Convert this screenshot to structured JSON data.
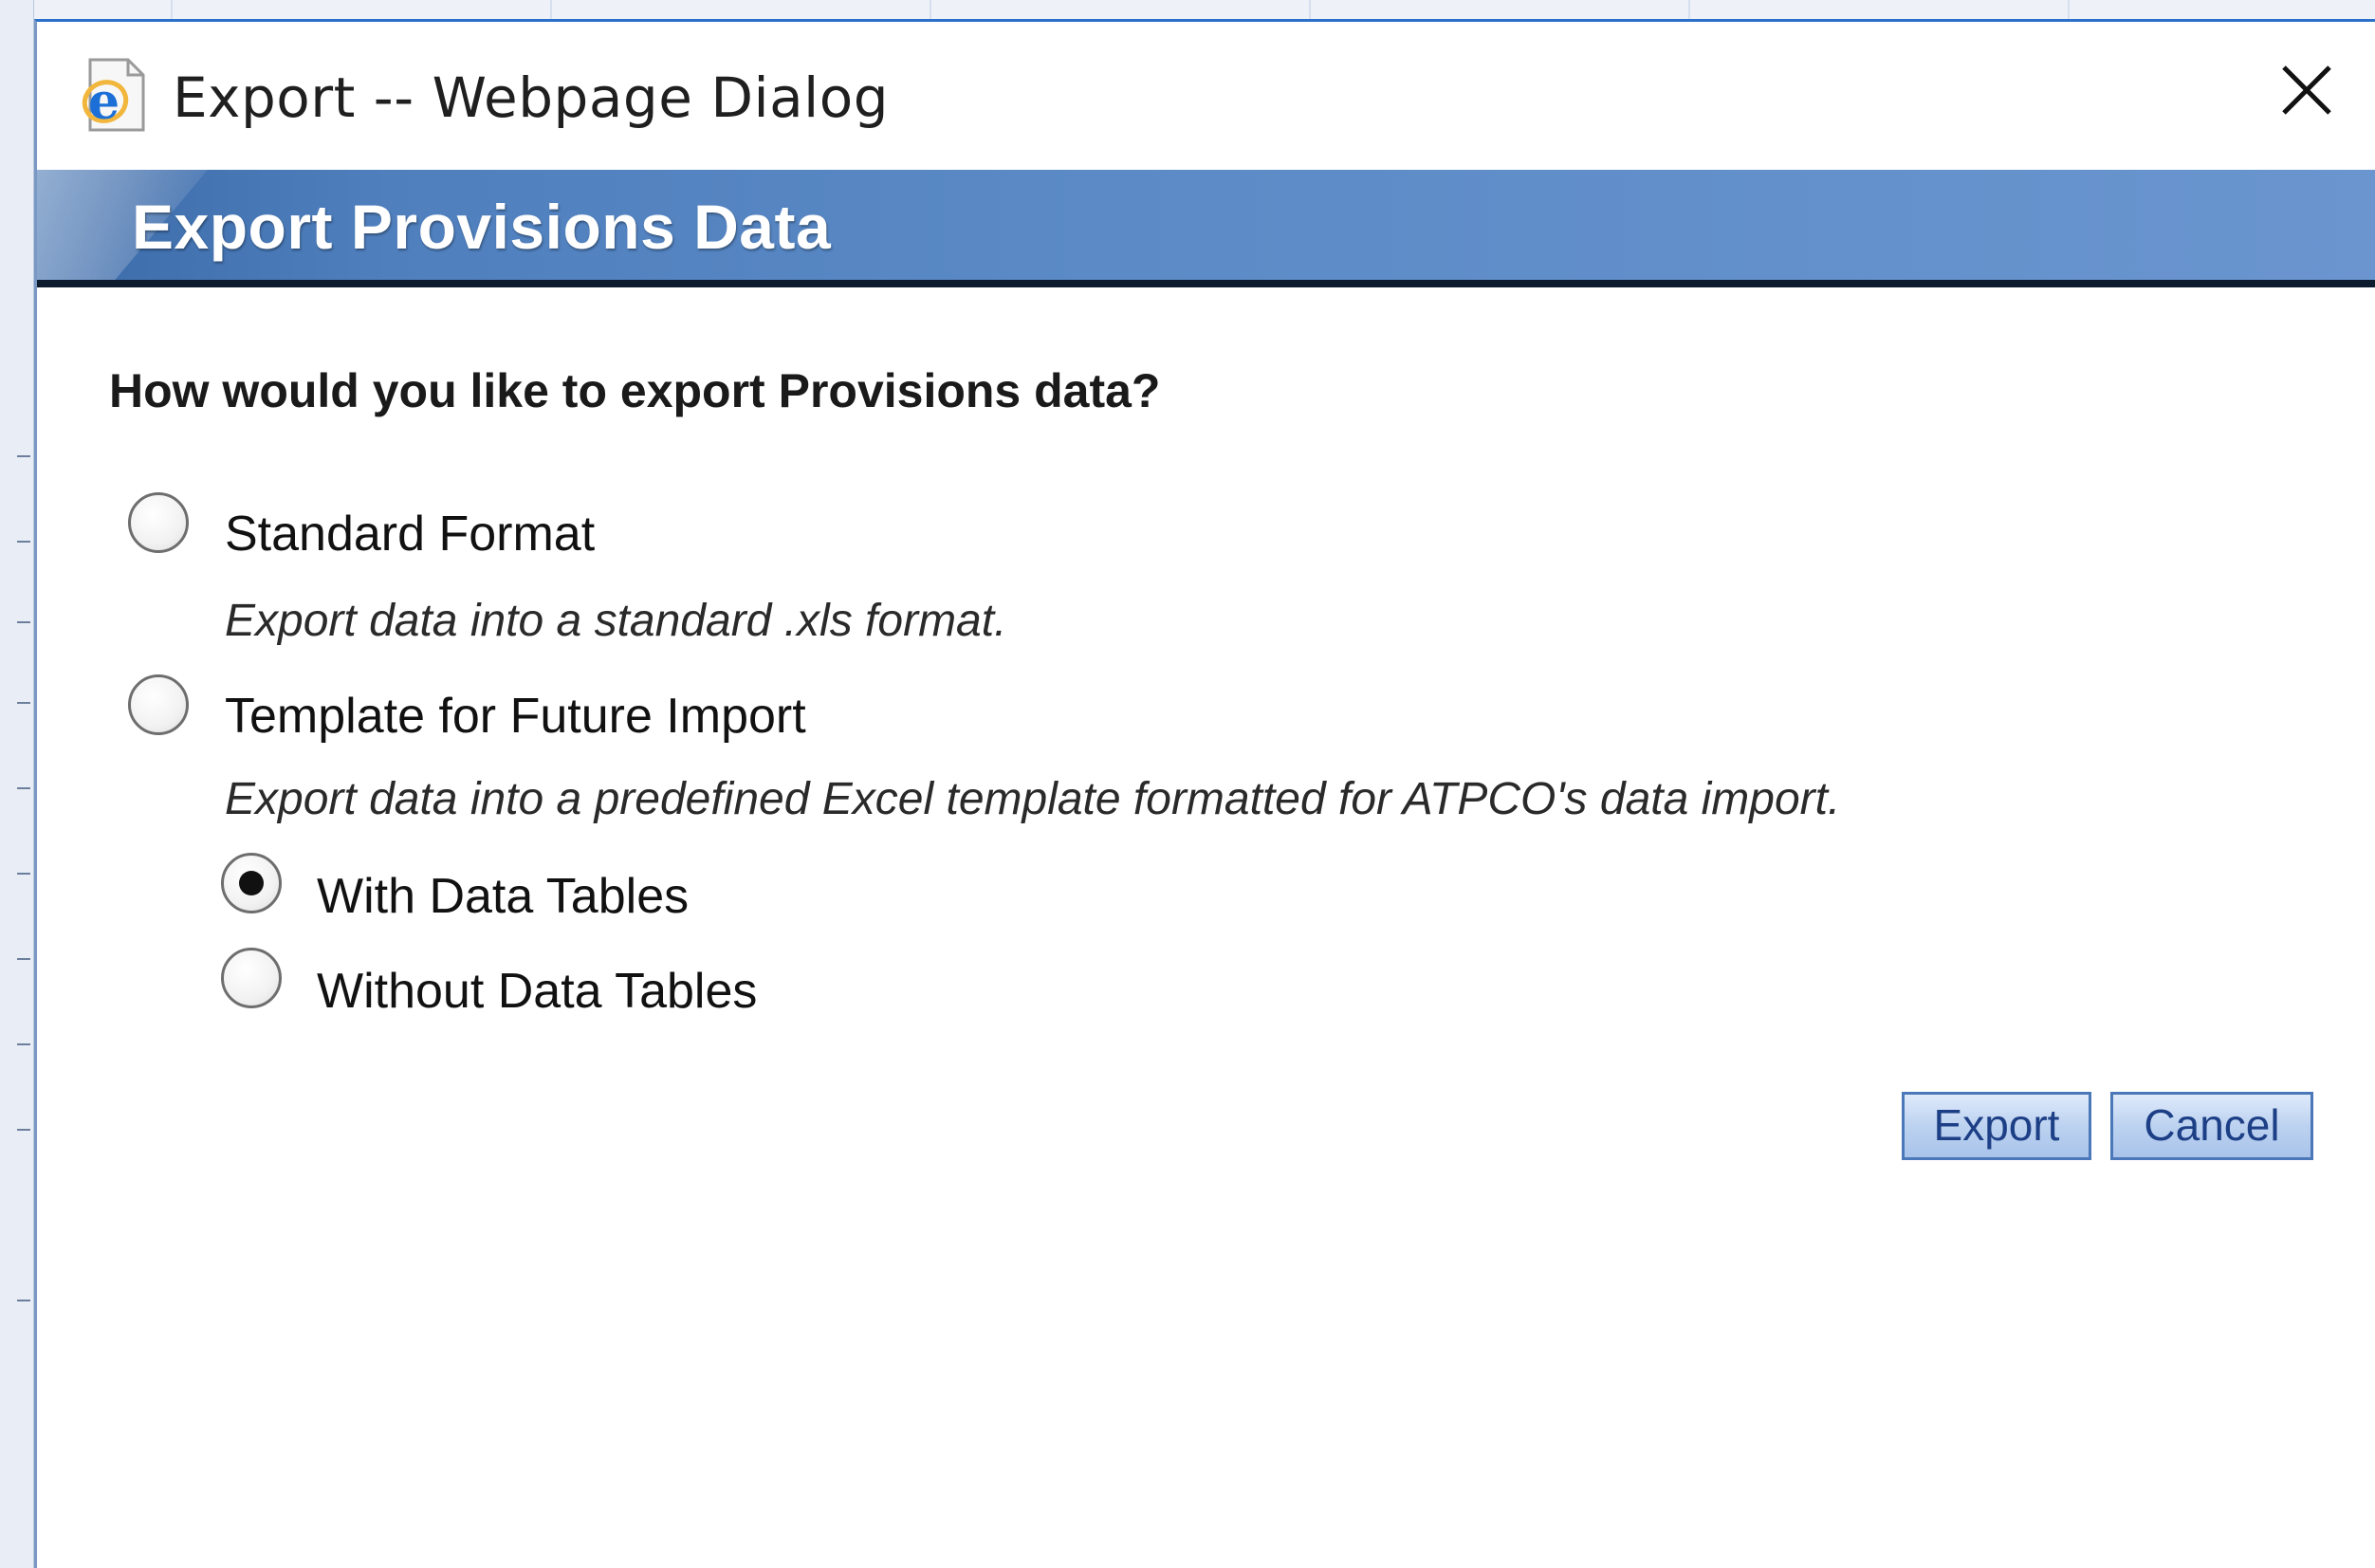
{
  "window": {
    "title": "Export -- Webpage Dialog",
    "close_symbol": "✕"
  },
  "banner": {
    "title": "Export Provisions Data"
  },
  "form": {
    "question": "How would you like to export Provisions data?",
    "options": [
      {
        "label": "Standard Format",
        "description": "Export data into a standard .xls format.",
        "selected": false
      },
      {
        "label": "Template for Future Import",
        "description": "Export data into a predefined Excel template formatted for ATPCO's data import.",
        "selected": false,
        "sub_options": [
          {
            "label": "With Data Tables",
            "selected": true
          },
          {
            "label": "Without Data Tables",
            "selected": false
          }
        ]
      }
    ]
  },
  "buttons": {
    "export_label": "Export",
    "cancel_label": "Cancel"
  },
  "icons": {
    "app": "internet-explorer-icon",
    "close": "close-icon"
  },
  "colors": {
    "banner_blue": "#5b8ac6",
    "button_border": "#4a78b8",
    "button_text": "#1d3f86"
  }
}
